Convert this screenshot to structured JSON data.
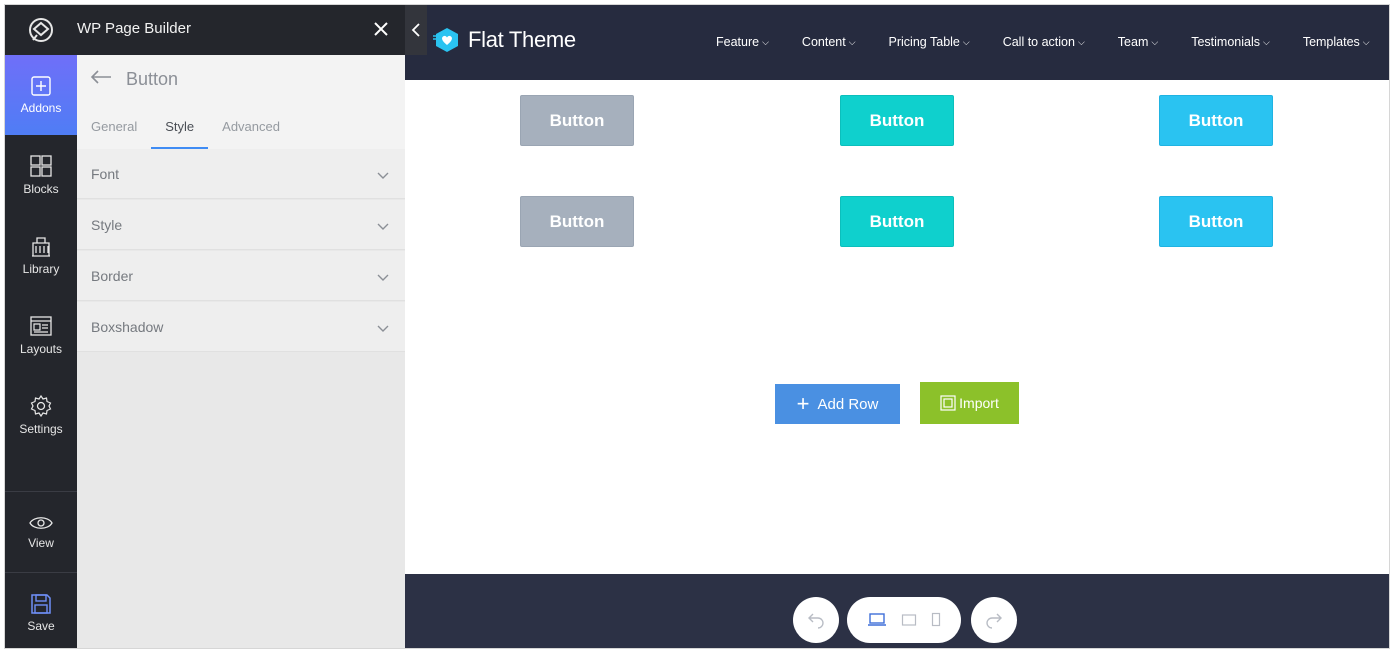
{
  "builder": {
    "title": "WP Page Builder",
    "rail": [
      {
        "label": "Addons",
        "icon": "plus-square-icon"
      },
      {
        "label": "Blocks",
        "icon": "blocks-icon"
      },
      {
        "label": "Library",
        "icon": "library-icon"
      },
      {
        "label": "Layouts",
        "icon": "layouts-icon"
      },
      {
        "label": "Settings",
        "icon": "gear-icon"
      },
      {
        "label": "View",
        "icon": "eye-icon"
      },
      {
        "label": "Save",
        "icon": "save-icon"
      }
    ],
    "element_title": "Button",
    "tabs": [
      "General",
      "Style",
      "Advanced"
    ],
    "active_tab": "Style",
    "sections": [
      "Font",
      "Style",
      "Border",
      "Boxshadow"
    ]
  },
  "site": {
    "brand": "Flat Theme",
    "nav": [
      "Feature",
      "Content",
      "Pricing Table",
      "Call to action",
      "Team",
      "Testimonials",
      "Templates"
    ],
    "buttons": [
      {
        "label": "Button",
        "style": "grey"
      },
      {
        "label": "Button",
        "style": "teal"
      },
      {
        "label": "Button",
        "style": "blue"
      },
      {
        "label": "Button",
        "style": "grey"
      },
      {
        "label": "Button",
        "style": "teal"
      },
      {
        "label": "Button",
        "style": "blue"
      }
    ],
    "add_row_label": "Add Row",
    "import_label": "Import"
  },
  "colors": {
    "rail_bg": "#24262c",
    "accent": "#4f7df5",
    "header_bg": "#262b3f",
    "footer_bg": "#2c3145",
    "grey_button": "#a6b0bd",
    "teal_button": "#0fd0cd",
    "blue_button": "#2ac3f1",
    "add_row": "#4a90e2",
    "import": "#8cc12a"
  }
}
